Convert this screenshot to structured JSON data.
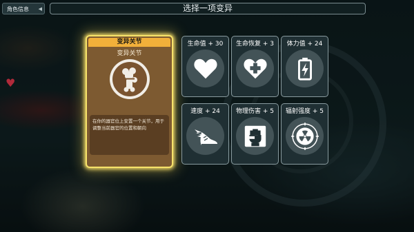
{
  "tab": {
    "label": "角色信息",
    "caret": "◀"
  },
  "title": "选择一项变异",
  "selected": {
    "header": "变异关节",
    "subtitle": "变异关节",
    "icon": "bone-joint-icon",
    "description": "在你的器官位上安置一个关节，用于调整当前器官的位置和朝向"
  },
  "options": [
    {
      "label": "生命值 + 30",
      "icon": "heart-icon"
    },
    {
      "label": "生命恢复 + 3",
      "icon": "heart-plus-icon"
    },
    {
      "label": "体力值 + 24",
      "icon": "battery-icon"
    },
    {
      "label": "速度 + 24",
      "icon": "winged-shoe-icon"
    },
    {
      "label": "物理伤害 + 5",
      "icon": "fist-icon"
    },
    {
      "label": "辐射强度 + 5",
      "icon": "radiation-icon"
    }
  ],
  "colors": {
    "highlight": "#f7e36a",
    "header": "#f2b03a",
    "card": "#7d5a31"
  }
}
